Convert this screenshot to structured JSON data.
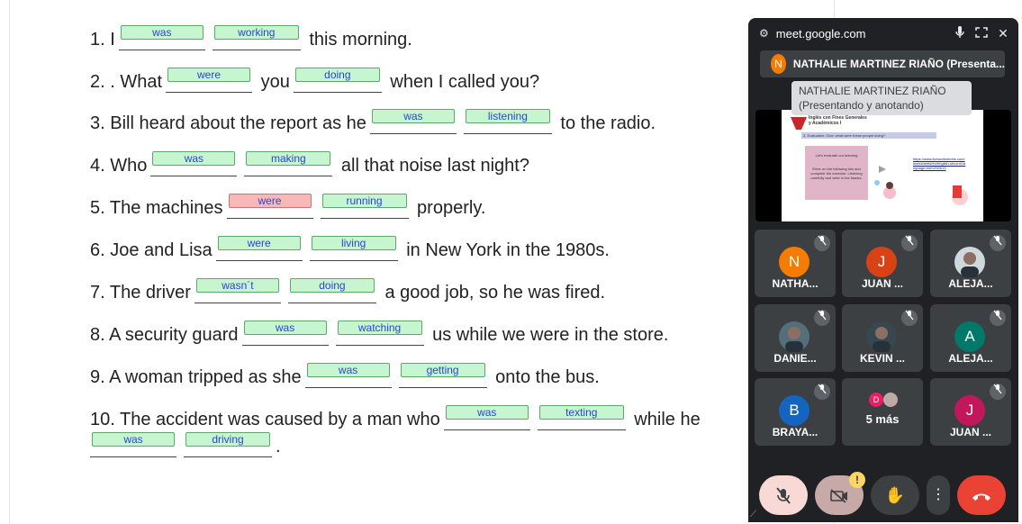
{
  "exercise": {
    "lines": [
      {
        "parts": [
          {
            "t": "1. I"
          },
          {
            "b": "was"
          },
          {
            "b": "working"
          },
          {
            "t": " this morning."
          }
        ]
      },
      {
        "parts": [
          {
            "t": "2. . What"
          },
          {
            "b": "were"
          },
          {
            "t": " you"
          },
          {
            "b": "doing"
          },
          {
            "t": " when I called you?"
          }
        ]
      },
      {
        "parts": [
          {
            "t": "3. Bill heard about the report as he"
          },
          {
            "b": "was"
          },
          {
            "b": "listening"
          },
          {
            "t": " to the radio."
          }
        ]
      },
      {
        "parts": [
          {
            "t": "4. Who"
          },
          {
            "b": "was"
          },
          {
            "b": "making"
          },
          {
            "t": " all that noise last night?"
          }
        ]
      },
      {
        "parts": [
          {
            "t": "5. The machines"
          },
          {
            "b": "were",
            "wrong": true
          },
          {
            "b": "running"
          },
          {
            "t": " properly."
          }
        ]
      },
      {
        "parts": [
          {
            "t": "6. Joe and Lisa"
          },
          {
            "b": "were"
          },
          {
            "b": "living"
          },
          {
            "t": " in New York in the 1980s."
          }
        ]
      },
      {
        "parts": [
          {
            "t": "7. The driver"
          },
          {
            "b": "wasn´t"
          },
          {
            "b": "doing"
          },
          {
            "t": " a good job, so he was fired."
          }
        ]
      },
      {
        "parts": [
          {
            "t": "8. A security guard"
          },
          {
            "b": "was"
          },
          {
            "b": "watching"
          },
          {
            "t": " us while we were in the store."
          }
        ]
      },
      {
        "parts": [
          {
            "t": "9. A woman tripped as she"
          },
          {
            "b": "was"
          },
          {
            "b": "getting"
          },
          {
            "t": " onto the bus."
          }
        ]
      },
      {
        "parts": [
          {
            "t": "10. The accident was caused by a man who"
          },
          {
            "b": "was"
          },
          {
            "b": "texting"
          },
          {
            "t": " while he"
          }
        ]
      },
      {
        "parts": [
          {
            "b": "was"
          },
          {
            "b": "driving"
          },
          {
            "t": "."
          }
        ]
      }
    ]
  },
  "meet": {
    "url": "meet.google.com",
    "presenter_label": "NATHALIE MARTINEZ RIAÑO (Presenta...",
    "presenter_initial": "N",
    "tooltip_line1": "NATHALIE MARTINEZ RIAÑO",
    "tooltip_line2": "(Presentando y anotando)",
    "slide": {
      "title1": "Inglés con Fines Generales",
      "title2": "y Académicos I",
      "subtitle": "3. Evaluation: Give: what were these people doing?",
      "box_text1": "Let's evaluate our learning",
      "box_text2": "Enter on the following link and complete the exercise. Listening carefully and write in the blanks.",
      "link": "https://www.liveworksheets.com/worksheets/en/english-second-language-esl/1250013"
    },
    "tiles": [
      {
        "name": "NATHA...",
        "initial": "N",
        "color": "#f57c00",
        "type": "initial"
      },
      {
        "name": "JUAN ...",
        "initial": "J",
        "color": "#d84315",
        "type": "initial"
      },
      {
        "name": "ALEJA...",
        "initial": "",
        "color": "#cfd8dc",
        "type": "photo"
      },
      {
        "name": "DANIE...",
        "initial": "",
        "color": "#546e7a",
        "type": "photo"
      },
      {
        "name": "KEVIN ...",
        "initial": "",
        "color": "#37474f",
        "type": "photo"
      },
      {
        "name": "ALEJA...",
        "initial": "A",
        "color": "#00796b",
        "type": "initial"
      },
      {
        "name": "BRAYA...",
        "initial": "B",
        "color": "#1565c0",
        "type": "initial"
      },
      {
        "name": "5 más",
        "initial": "",
        "color": "",
        "type": "more"
      },
      {
        "name": "JUAN ...",
        "initial": "J",
        "color": "#c2185b",
        "type": "initial"
      }
    ],
    "more_initial": "D",
    "warning_badge": "!"
  }
}
